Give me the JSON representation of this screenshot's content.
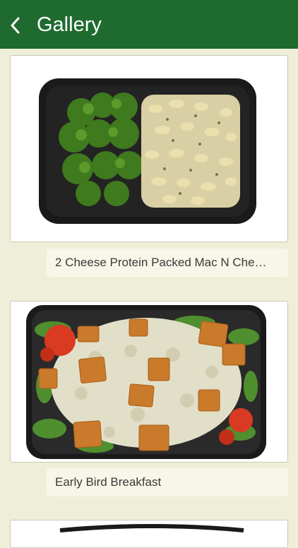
{
  "header": {
    "title": "Gallery",
    "back_icon": "chevron-left-icon"
  },
  "colors": {
    "header_bg": "#1f6b2f",
    "page_bg": "#efefd9",
    "caption_bg": "#f7f6e9"
  },
  "gallery": {
    "items": [
      {
        "caption": "2 Cheese Protein Packed Mac N Che…"
      },
      {
        "caption": "Early Bird Breakfast"
      },
      {
        "caption": ""
      }
    ]
  }
}
